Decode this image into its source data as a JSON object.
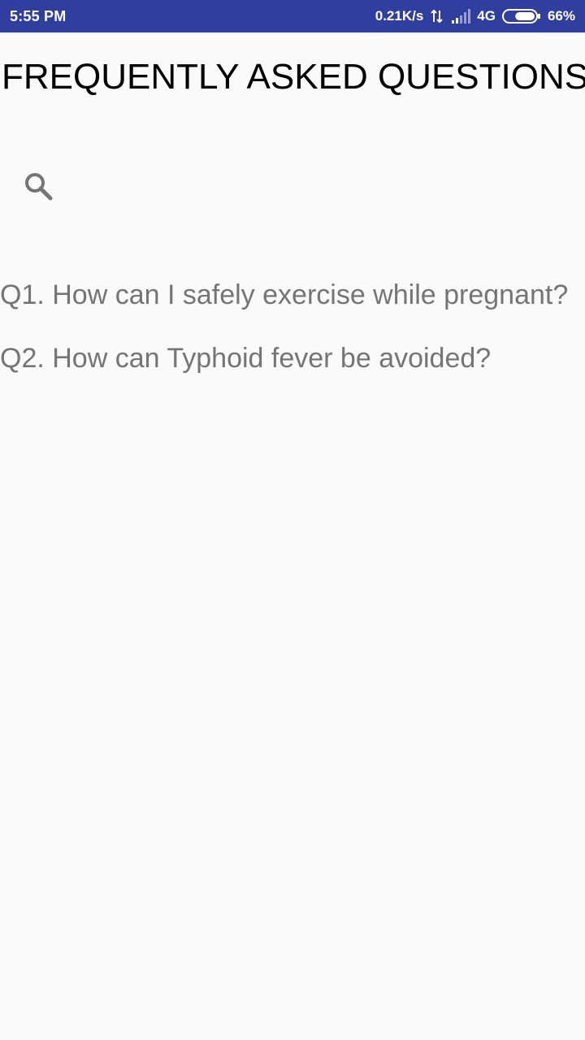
{
  "status_bar": {
    "time": "5:55 PM",
    "network_speed": "0.21K/s",
    "network_type": "4G",
    "battery_percent": "66%",
    "battery_level": 0.66,
    "icons": [
      "data-transfer-icon",
      "signal-icon",
      "battery-icon"
    ]
  },
  "page": {
    "title": "FREQUENTLY ASKED QUESTIONS"
  },
  "search": {
    "icon": "search-icon"
  },
  "faq": {
    "items": [
      {
        "label": "Q1. How can I safely exercise while pregnant?"
      },
      {
        "label": "Q2. How can Typhoid fever be avoided?"
      }
    ]
  },
  "colors": {
    "status_bar": "#303f9f",
    "background": "#fafafa",
    "title": "#000000",
    "question_text": "#757575",
    "icon": "#757575"
  }
}
